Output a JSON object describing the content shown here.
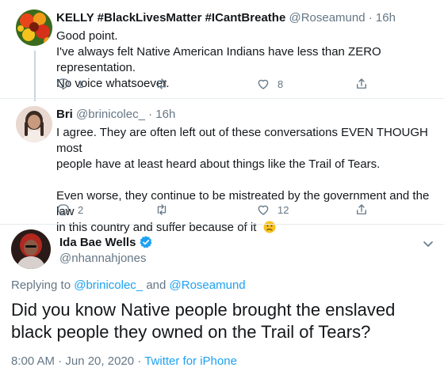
{
  "tweets": [
    {
      "name": "KELLY #BlackLivesMatter #ICantBreathe",
      "handle": "@Roseamund",
      "sep": "·",
      "time": "16h",
      "lines": [
        "Good point.",
        "I've always felt Native American Indians have less than ZERO representation.",
        "No voice whatsoever."
      ],
      "replies": "1",
      "retweets": "",
      "likes": "8"
    },
    {
      "name": "Bri",
      "handle": "@brinicolec_",
      "sep": "·",
      "time": "16h",
      "lines": [
        "I agree. They are often left out of these conversations EVEN THOUGH most",
        "people have at least heard about things like the Trail of Tears.",
        "",
        "Even worse, they continue to be mistreated by the government and the law",
        "in this country and suffer because of it"
      ],
      "emoji": "😕",
      "replies": "2",
      "retweets": "",
      "likes": "12"
    }
  ],
  "main_tweet": {
    "name": "Ida Bae Wells",
    "handle": "@nhannahjones",
    "replying_prefix": "Replying to",
    "replying_to_1": "@brinicolec_",
    "replying_and": "and",
    "replying_to_2": "@Roseamund",
    "text_line1": "Did you know Native people brought the enslaved",
    "text_line2": "black people they owned on the Trail of Tears?",
    "timestamp": "8:00 AM · Jun 20, 2020 ·",
    "source": "Twitter for iPhone"
  },
  "colors": {
    "accent": "#1da1f2",
    "muted": "#657786",
    "text": "#14171a"
  },
  "icons": [
    "reply-icon",
    "retweet-icon",
    "like-icon",
    "share-icon",
    "verified-icon",
    "chevron-down-icon"
  ]
}
